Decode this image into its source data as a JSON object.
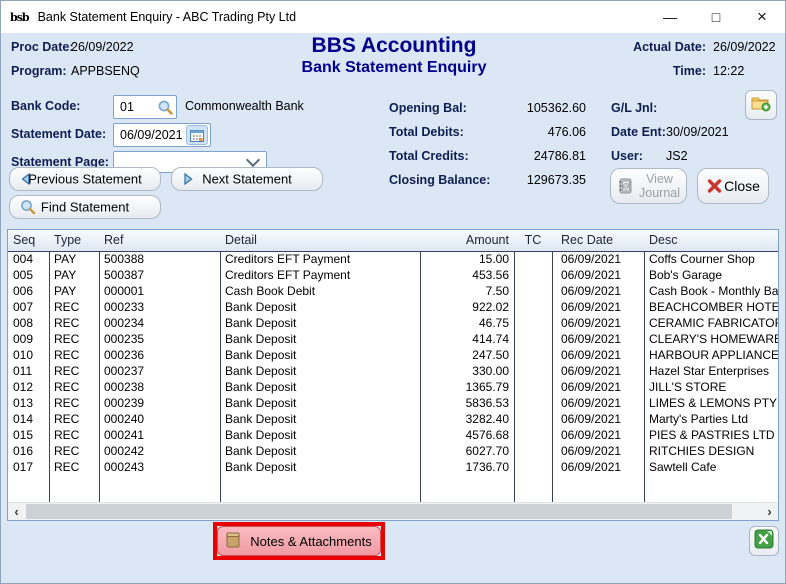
{
  "window": {
    "title": "Bank Statement Enquiry - ABC Trading Pty Ltd",
    "icon_text": "bsb",
    "minimize": "—",
    "maximize": "□",
    "close": "×"
  },
  "header": {
    "proc_date_label": "Proc Date:",
    "proc_date": "26/09/2022",
    "program_label": "Program:",
    "program": "APPBSENQ",
    "app_title": "BBS Accounting",
    "screen_title": "Bank Statement Enquiry",
    "actual_date_label": "Actual Date:",
    "actual_date": "26/09/2022",
    "time_label": "Time:",
    "time": "12:22"
  },
  "form": {
    "bank_code_label": "Bank Code:",
    "bank_code": "01",
    "bank_name": "Commonwealth Bank",
    "statement_date_label": "Statement Date:",
    "statement_date": "06/09/2021",
    "statement_page_label": "Statement Page:",
    "statement_page": "",
    "opening_bal_label": "Opening Bal:",
    "opening_bal": "105362.60",
    "total_debits_label": "Total Debits:",
    "total_debits": "476.06",
    "total_credits_label": "Total Credits:",
    "total_credits": "24786.81",
    "closing_balance_label": "Closing Balance:",
    "closing_balance": "129673.35",
    "gl_jnl_label": "G/L Jnl:",
    "gl_jnl": "",
    "date_ent_label": "Date Ent:",
    "date_ent": "30/09/2021",
    "user_label": "User:",
    "user": "JS2"
  },
  "buttons": {
    "previous_statement": "Previous Statement",
    "next_statement": "Next Statement",
    "find_statement": "Find Statement",
    "view_journal": "View Journal",
    "close": "Close",
    "notes_attachments": "Notes & Attachments"
  },
  "scrollbar": {
    "left_arrow": "‹",
    "right_arrow": "›"
  },
  "table": {
    "columns": [
      "Seq",
      "Type",
      "Ref",
      "Detail",
      "Amount",
      "TC",
      "Rec Date",
      "Desc"
    ],
    "rows": [
      [
        "004",
        "PAY",
        "500388",
        "Creditors EFT Payment",
        "15.00",
        "",
        "06/09/2021",
        "Coffs Courner Shop"
      ],
      [
        "005",
        "PAY",
        "500387",
        "Creditors EFT Payment",
        "453.56",
        "",
        "06/09/2021",
        "Bob's Garage"
      ],
      [
        "006",
        "PAY",
        "000001",
        "Cash Book Debit",
        "7.50",
        "",
        "06/09/2021",
        "Cash Book - Monthly Bank"
      ],
      [
        "007",
        "REC",
        "000233",
        "Bank Deposit",
        "922.02",
        "",
        "06/09/2021",
        "BEACHCOMBER HOTEL"
      ],
      [
        "008",
        "REC",
        "000234",
        "Bank Deposit",
        "46.75",
        "",
        "06/09/2021",
        "CERAMIC FABRICATORS"
      ],
      [
        "009",
        "REC",
        "000235",
        "Bank Deposit",
        "414.74",
        "",
        "06/09/2021",
        "CLEARY'S HOMEWARES"
      ],
      [
        "010",
        "REC",
        "000236",
        "Bank Deposit",
        "247.50",
        "",
        "06/09/2021",
        "HARBOUR APPLIANCES"
      ],
      [
        "011",
        "REC",
        "000237",
        "Bank Deposit",
        "330.00",
        "",
        "06/09/2021",
        "Hazel Star Enterprises"
      ],
      [
        "012",
        "REC",
        "000238",
        "Bank Deposit",
        "1365.79",
        "",
        "06/09/2021",
        "JILL'S STORE"
      ],
      [
        "013",
        "REC",
        "000239",
        "Bank Deposit",
        "5836.53",
        "",
        "06/09/2021",
        "LIMES & LEMONS PTY LTD"
      ],
      [
        "014",
        "REC",
        "000240",
        "Bank Deposit",
        "3282.40",
        "",
        "06/09/2021",
        "Marty's Parties Ltd"
      ],
      [
        "015",
        "REC",
        "000241",
        "Bank Deposit",
        "4576.68",
        "",
        "06/09/2021",
        "PIES & PASTRIES LTD"
      ],
      [
        "016",
        "REC",
        "000242",
        "Bank Deposit",
        "6027.70",
        "",
        "06/09/2021",
        "RITCHIES DESIGN"
      ],
      [
        "017",
        "REC",
        "000243",
        "Bank Deposit",
        "1736.70",
        "",
        "06/09/2021",
        "Sawtell Cafe"
      ]
    ]
  },
  "colors": {
    "brand_blue": "#00008B",
    "label_navy": "#0E1E52",
    "highlight_red": "#E80202",
    "notes_pink": "#F4A3AC",
    "excel_green": "#43A047",
    "window_bg": "#DCE7F5"
  }
}
